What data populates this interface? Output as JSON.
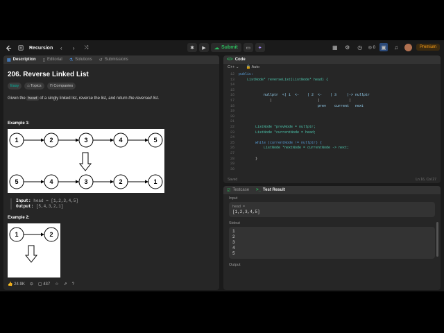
{
  "topbar": {
    "problem_list_label": "Recursion",
    "submit_label": "Submit",
    "coin_count": "0",
    "premium_label": "Premium"
  },
  "left_tabs": [
    {
      "label": "Description"
    },
    {
      "label": "Editorial"
    },
    {
      "label": "Solutions"
    },
    {
      "label": "Submissions"
    }
  ],
  "problem": {
    "title": "206. Reverse Linked List",
    "difficulty": "Easy",
    "topics_label": "Topics",
    "companies_label": "Companies",
    "stmt_a": "Given the ",
    "stmt_code": "head",
    "stmt_b": " of a singly linked list, reverse the list, and return ",
    "stmt_em": "the reversed list",
    "stmt_c": "."
  },
  "example1": {
    "title": "Example 1:",
    "top_nodes": [
      "1",
      "2",
      "3",
      "4",
      "5"
    ],
    "bottom_nodes": [
      "5",
      "4",
      "3",
      "2",
      "1"
    ],
    "input_label": "Input:",
    "input_value": "head = [1,2,3,4,5]",
    "output_label": "Output:",
    "output_value": "[5,4,3,2,1]"
  },
  "example2": {
    "title": "Example 2:",
    "top_nodes": [
      "1",
      "2"
    ]
  },
  "footer": {
    "likes": "24.9K",
    "comments": "437"
  },
  "code_panel": {
    "tab_label": "Code",
    "language": "C++",
    "mode": "Auto",
    "status_left": "Saved",
    "status_right": "Ln 16, Col 27",
    "lines": [
      {
        "n": "12",
        "text": "public:"
      },
      {
        "n": "13",
        "text": "    ListNode* reverseList(ListNode* head) {"
      },
      {
        "n": "14",
        "text": ""
      },
      {
        "n": "15",
        "text": ""
      },
      {
        "n": "16",
        "text": "            nullptr  <| 1  <-    | 2  <-    | 3     |-> nullptr"
      },
      {
        "n": "17",
        "text": "               |                      |              |"
      },
      {
        "n": "18",
        "text": "                                      prev    current   next"
      },
      {
        "n": "19",
        "text": ""
      },
      {
        "n": "20",
        "text": ""
      },
      {
        "n": "21",
        "text": ""
      },
      {
        "n": "22",
        "text": "        ListNode *prevNode = nullptr;"
      },
      {
        "n": "23",
        "text": "        ListNode *currentNode = head;"
      },
      {
        "n": "24",
        "text": ""
      },
      {
        "n": "25",
        "text": "        while (currentNode != nullptr) {"
      },
      {
        "n": "26",
        "text": "            ListNode *nextNode = currentNode -> next;"
      },
      {
        "n": "27",
        "text": ""
      },
      {
        "n": "28",
        "text": "        }"
      },
      {
        "n": "29",
        "text": ""
      },
      {
        "n": "30",
        "text": ""
      }
    ]
  },
  "test_panel": {
    "tab1": "Testcase",
    "tab2": "Test Result",
    "input_label": "Input",
    "head_label": "head =",
    "head_value": "[1,2,3,4,5]",
    "stdout_label": "Stdout",
    "stdout_lines": [
      "1",
      "2",
      "3",
      "4",
      "5"
    ],
    "output_label": "Output"
  },
  "colors": {
    "accent_green": "#2cbb5d",
    "premium": "#ffa116",
    "easy": "#00b8a3"
  }
}
